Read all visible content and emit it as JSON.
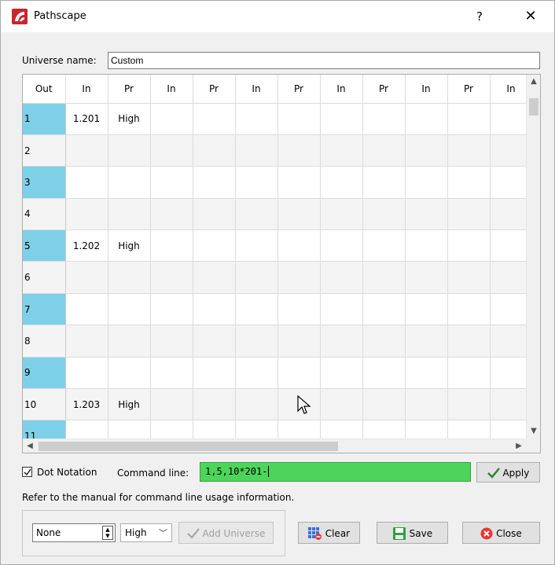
{
  "window": {
    "title": "Pathscape",
    "help": "?",
    "close": "✕"
  },
  "universe": {
    "label": "Universe name:",
    "value": "Custom"
  },
  "table": {
    "headers": [
      "Out",
      "In",
      "Pr",
      "In",
      "Pr",
      "In",
      "Pr",
      "In",
      "Pr",
      "In",
      "Pr",
      "In"
    ],
    "rows": [
      {
        "out": "1",
        "in": "1.201",
        "pr": "High"
      },
      {
        "out": "2",
        "in": "",
        "pr": ""
      },
      {
        "out": "3",
        "in": "",
        "pr": ""
      },
      {
        "out": "4",
        "in": "",
        "pr": ""
      },
      {
        "out": "5",
        "in": "1.202",
        "pr": "High"
      },
      {
        "out": "6",
        "in": "",
        "pr": ""
      },
      {
        "out": "7",
        "in": "",
        "pr": ""
      },
      {
        "out": "8",
        "in": "",
        "pr": ""
      },
      {
        "out": "9",
        "in": "",
        "pr": ""
      },
      {
        "out": "10",
        "in": "1.203",
        "pr": "High"
      },
      {
        "out": "11",
        "in": "",
        "pr": ""
      }
    ]
  },
  "dot_notation": {
    "label": "Dot Notation",
    "checked": true
  },
  "command": {
    "label": "Command line:",
    "value": "1,5,10*201-"
  },
  "buttons": {
    "apply": "Apply",
    "add_universe": "Add Universe",
    "clear": "Clear",
    "save": "Save",
    "close": "Close"
  },
  "info": "Refer to the manual for command line usage information.",
  "priority_spin": {
    "value": "None"
  },
  "priority_combo": {
    "value": "High"
  },
  "colors": {
    "row_header": "#7ed0e8",
    "command_bg": "#4cd55a",
    "app_icon": "#c8262e"
  }
}
